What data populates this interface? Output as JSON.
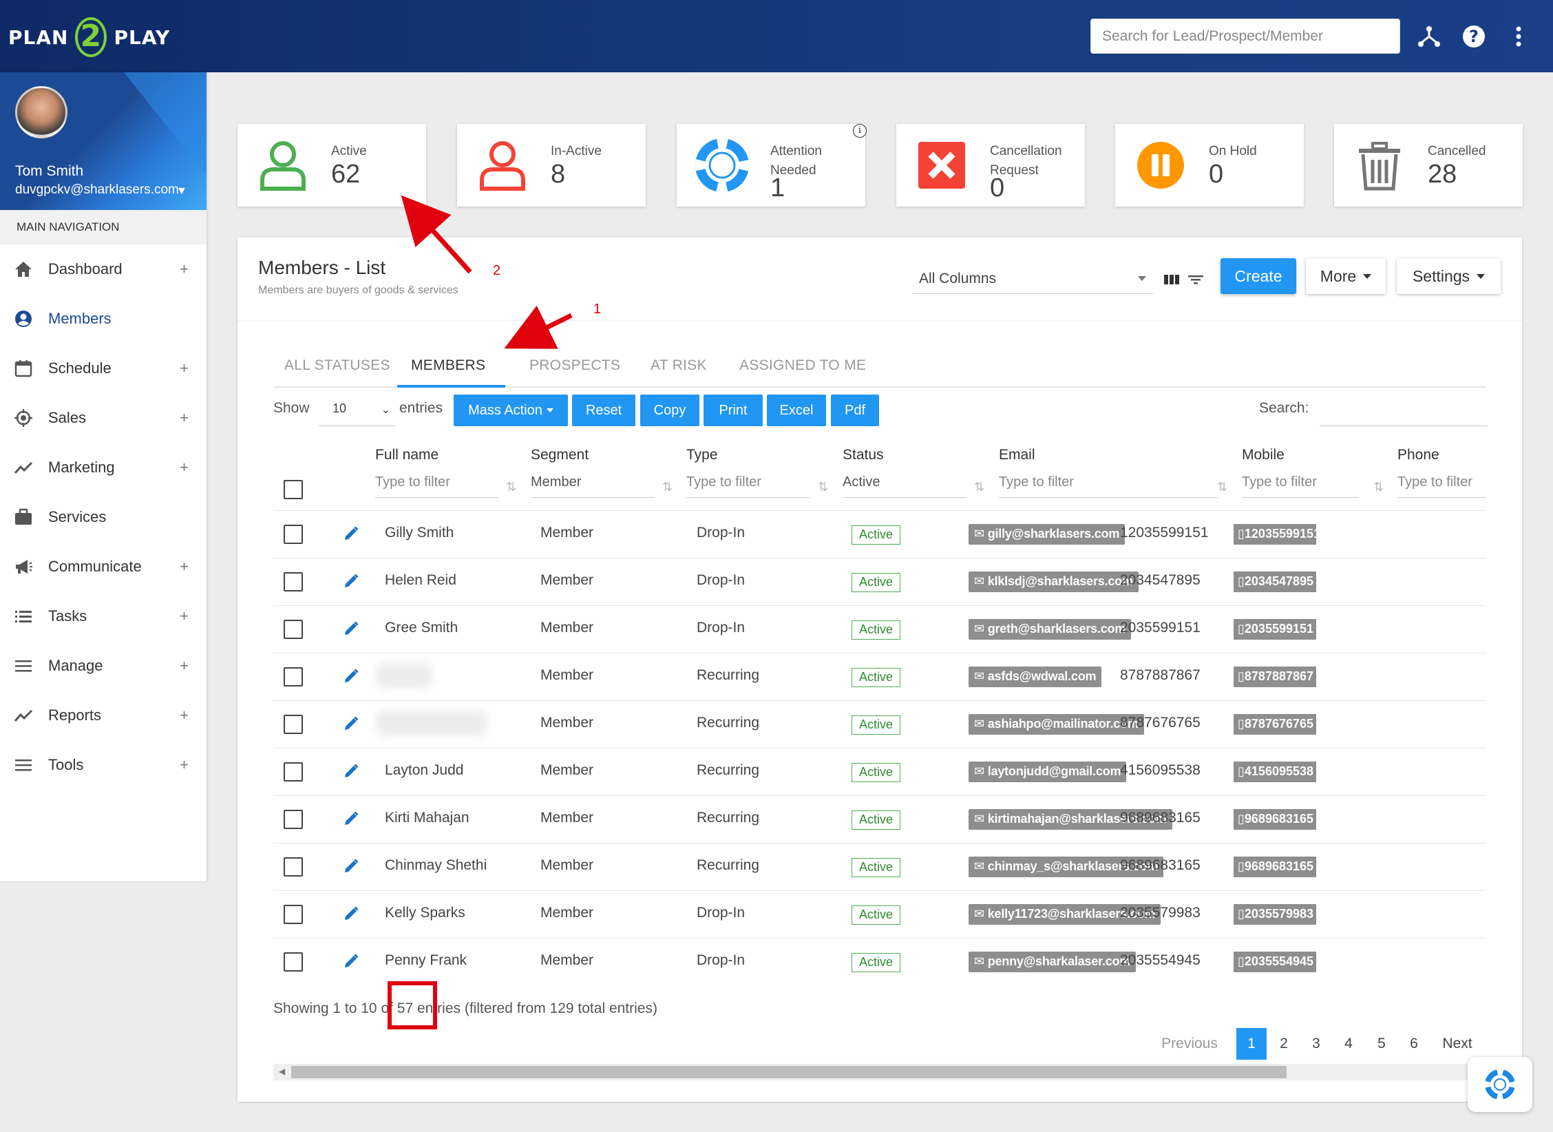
{
  "app": {
    "logo_left": "PLAN",
    "logo_mid": "2",
    "logo_right": "PLAY",
    "search_placeholder": "Search for Lead/Prospect/Member"
  },
  "profile": {
    "name": "Tom Smith",
    "email": "duvgpckv@sharklasers.com"
  },
  "sidebar": {
    "heading": "MAIN NAVIGATION",
    "items": [
      {
        "label": "Dashboard",
        "icon": "home-icon",
        "plus": "+"
      },
      {
        "label": "Members",
        "icon": "user-circle-icon",
        "plus": ""
      },
      {
        "label": "Schedule",
        "icon": "calendar-icon",
        "plus": "+"
      },
      {
        "label": "Sales",
        "icon": "target-icon",
        "plus": "+"
      },
      {
        "label": "Marketing",
        "icon": "trend-icon",
        "plus": "+"
      },
      {
        "label": "Services",
        "icon": "briefcase-icon",
        "plus": ""
      },
      {
        "label": "Communicate",
        "icon": "megaphone-icon",
        "plus": "+"
      },
      {
        "label": "Tasks",
        "icon": "list-icon",
        "plus": "+"
      },
      {
        "label": "Manage",
        "icon": "menu-icon",
        "plus": "+"
      },
      {
        "label": "Reports",
        "icon": "trend-icon",
        "plus": "+"
      },
      {
        "label": "Tools",
        "icon": "menu-icon",
        "plus": "+"
      }
    ]
  },
  "stats": [
    {
      "label": "Active",
      "value": "62",
      "color": "#4caf50"
    },
    {
      "label": "In-Active",
      "value": "8",
      "color": "#f44336"
    },
    {
      "label": "Attention Needed",
      "value": "1",
      "color": "#2196f3"
    },
    {
      "label": "Cancellation Request",
      "value": "0",
      "color": "#f44336"
    },
    {
      "label": "On Hold",
      "value": "0",
      "color": "#ff9800"
    },
    {
      "label": "Cancelled",
      "value": "28",
      "color": "#757575"
    }
  ],
  "panel": {
    "title": "Members - List",
    "subtitle": "Members are buyers of goods & services",
    "column_select": "All Columns",
    "create": "Create",
    "more": "More",
    "settings": "Settings"
  },
  "tabs": [
    "ALL STATUSES",
    "MEMBERS",
    "PROSPECTS",
    "AT RISK",
    "ASSIGNED TO ME"
  ],
  "controls": {
    "show": "Show",
    "page_size": "10",
    "entries": "entries",
    "mass_action": "Mass Action",
    "reset": "Reset",
    "copy": "Copy",
    "print": "Print",
    "excel": "Excel",
    "pdf": "Pdf",
    "search_label": "Search:"
  },
  "table": {
    "columns": [
      "Full name",
      "Segment",
      "Type",
      "Status",
      "Email",
      "Mobile",
      "Phone"
    ],
    "filters": [
      "Type to filter",
      "Member",
      "Type to filter",
      "Active",
      "Type to filter",
      "Type to filter",
      "Type to filter"
    ],
    "rows": [
      {
        "name": "Gilly Smith",
        "segment": "Member",
        "type": "Drop-In",
        "status": "Active",
        "email": "gilly@sharklasers.com",
        "mobile": "12035599151",
        "phone": "12035599151"
      },
      {
        "name": "Helen Reid",
        "segment": "Member",
        "type": "Drop-In",
        "status": "Active",
        "email": "klklsdj@sharklasers.com",
        "mobile": "2034547895",
        "phone": "2034547895"
      },
      {
        "name": "Gree Smith",
        "segment": "Member",
        "type": "Drop-In",
        "status": "Active",
        "email": "greth@sharklasers.com",
        "mobile": "2035599151",
        "phone": "2035599151"
      },
      {
        "name": "",
        "segment": "Member",
        "type": "Recurring",
        "status": "Active",
        "email": "asfds@wdwal.com",
        "mobile": "8787887867",
        "phone": "8787887867"
      },
      {
        "name": "",
        "segment": "Member",
        "type": "Recurring",
        "status": "Active",
        "email": "ashiahpo@mailinator.com",
        "mobile": "8787676765",
        "phone": "8787676765"
      },
      {
        "name": "Layton Judd",
        "segment": "Member",
        "type": "Recurring",
        "status": "Active",
        "email": "laytonjudd@gmail.com",
        "mobile": "4156095538",
        "phone": "4156095538"
      },
      {
        "name": "Kirti Mahajan",
        "segment": "Member",
        "type": "Recurring",
        "status": "Active",
        "email": "kirtimahajan@sharklasers.com",
        "mobile": "9689683165",
        "phone": "9689683165"
      },
      {
        "name": "Chinmay Shethi",
        "segment": "Member",
        "type": "Recurring",
        "status": "Active",
        "email": "chinmay_s@sharklasers.com",
        "mobile": "9689683165",
        "phone": "9689683165"
      },
      {
        "name": "Kelly Sparks",
        "segment": "Member",
        "type": "Drop-In",
        "status": "Active",
        "email": "kelly11723@sharklasers.com",
        "mobile": "2035579983",
        "phone": "2035579983"
      },
      {
        "name": "Penny Frank",
        "segment": "Member",
        "type": "Drop-In",
        "status": "Active",
        "email": "penny@sharkalaser.com",
        "mobile": "2035554945",
        "phone": "2035554945"
      }
    ]
  },
  "footer": {
    "showing": "Showing 1 to 10 of 57 entries (filtered from 129 total entries)",
    "previous": "Previous",
    "pages": [
      "1",
      "2",
      "3",
      "4",
      "5",
      "6"
    ],
    "next": "Next"
  },
  "annotations": {
    "one": "1",
    "two": "2"
  }
}
